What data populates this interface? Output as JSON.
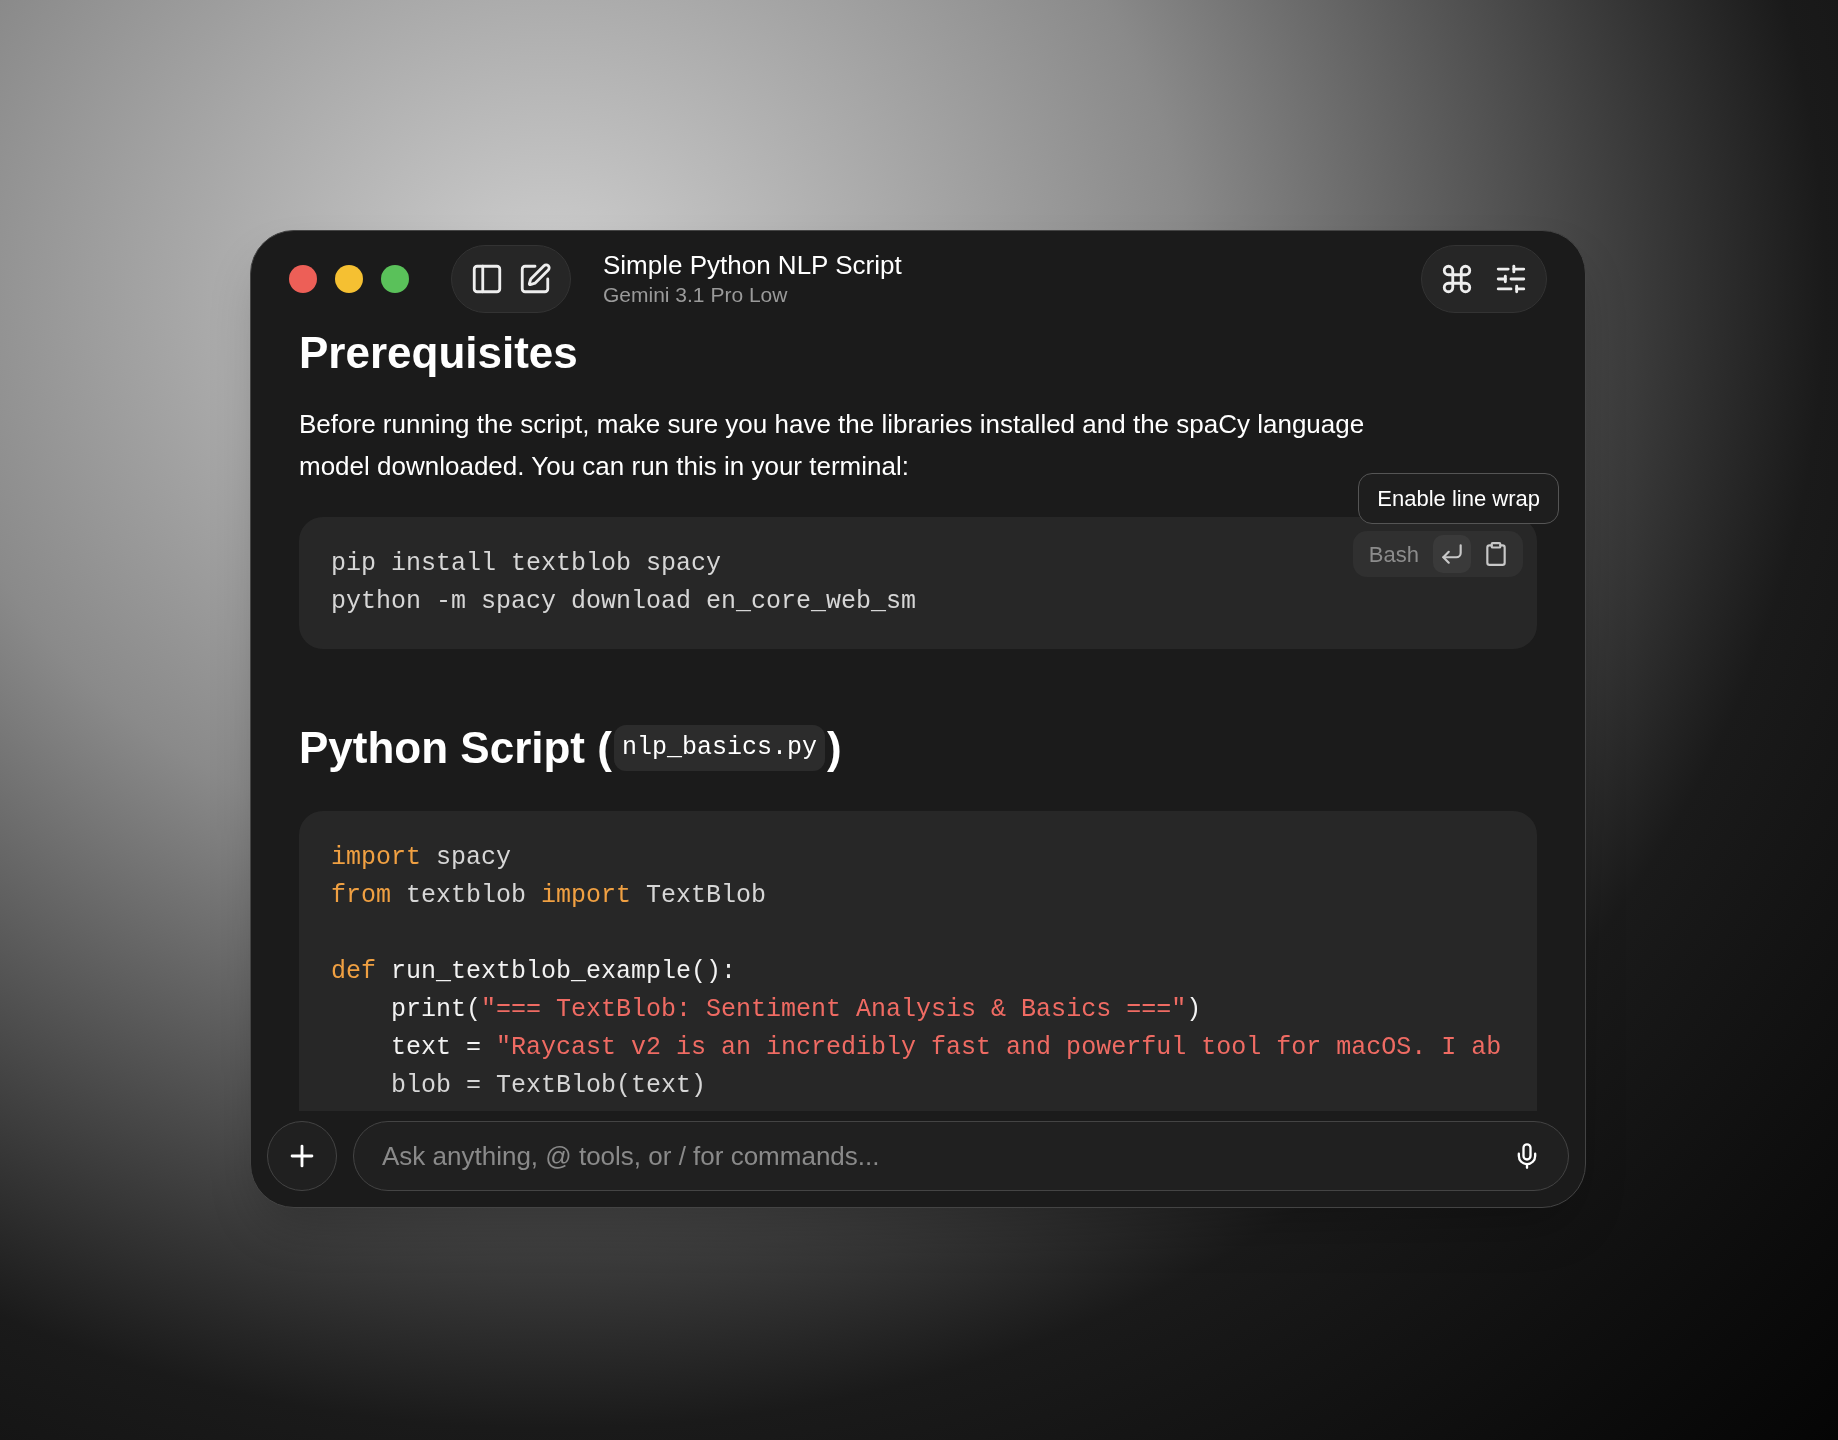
{
  "window": {
    "title": "Simple Python NLP Script",
    "subtitle": "Gemini 3.1 Pro Low"
  },
  "content": [
    {
      "kind": "heading",
      "text": "Prerequisites"
    },
    {
      "kind": "paragraph",
      "text": "Before running the script, make sure you have the libraries installed and the spaCy language model downloaded. You can run this in your terminal:"
    },
    {
      "kind": "code",
      "language": "Bash",
      "tooltip": "Enable line wrap",
      "lines": [
        {
          "kind": "text",
          "tokens": [
            {
              "kind": "plain",
              "s": "pip install textblob spacy"
            }
          ]
        },
        {
          "kind": "text",
          "tokens": [
            {
              "kind": "plain",
              "s": "python -m spacy download en_core_web_sm"
            }
          ]
        }
      ]
    },
    {
      "kind": "code_heading",
      "before": "Python Script (",
      "code": "nlp_basics.py",
      "after": ")"
    },
    {
      "kind": "code",
      "lines": [
        {
          "kind": "text",
          "tokens": [
            {
              "kind": "keyword",
              "s": "import"
            },
            {
              "kind": "plain",
              "s": " spacy"
            }
          ]
        },
        {
          "kind": "text",
          "tokens": [
            {
              "kind": "keyword",
              "s": "from"
            },
            {
              "kind": "plain",
              "s": " textblob "
            },
            {
              "kind": "keyword",
              "s": "import"
            },
            {
              "kind": "plain",
              "s": " TextBlob"
            }
          ]
        },
        {
          "kind": "blank"
        },
        {
          "kind": "text",
          "tokens": [
            {
              "kind": "keyword",
              "s": "def"
            },
            {
              "kind": "name",
              "s": " run_textblob_example():"
            }
          ]
        },
        {
          "kind": "text",
          "tokens": [
            {
              "kind": "name",
              "s": "    print("
            },
            {
              "kind": "string",
              "s": "\"=== TextBlob: Sentiment Analysis & Basics ===\""
            },
            {
              "kind": "name",
              "s": ")"
            }
          ]
        },
        {
          "kind": "text",
          "tokens": [
            {
              "kind": "name",
              "s": "    text = "
            },
            {
              "kind": "string",
              "s": "\"Raycast v2 is an incredibly fast and powerful tool for macOS. I ab"
            }
          ]
        },
        {
          "kind": "text",
          "tokens": [
            {
              "kind": "plain",
              "s": "    blob = TextBlob(text)"
            }
          ]
        }
      ]
    }
  ],
  "composer": {
    "placeholder": "Ask anything, @ tools, or / for commands..."
  }
}
